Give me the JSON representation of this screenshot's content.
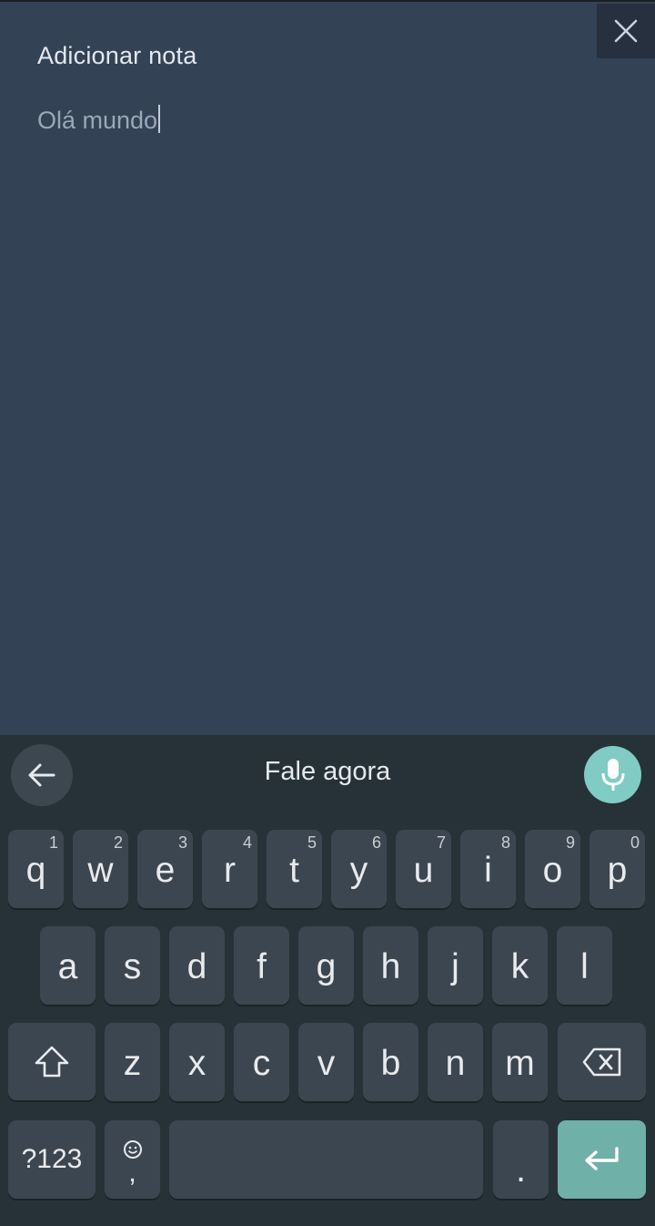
{
  "note": {
    "title": "Adicionar nota",
    "text": "Olá mundo"
  },
  "keyboard": {
    "voice_prompt": "Fale agora",
    "row1": [
      {
        "label": "q",
        "hint": "1"
      },
      {
        "label": "w",
        "hint": "2"
      },
      {
        "label": "e",
        "hint": "3"
      },
      {
        "label": "r",
        "hint": "4"
      },
      {
        "label": "t",
        "hint": "5"
      },
      {
        "label": "y",
        "hint": "6"
      },
      {
        "label": "u",
        "hint": "7"
      },
      {
        "label": "i",
        "hint": "8"
      },
      {
        "label": "o",
        "hint": "9"
      },
      {
        "label": "p",
        "hint": "0"
      }
    ],
    "row2": [
      "a",
      "s",
      "d",
      "f",
      "g",
      "h",
      "j",
      "k",
      "l"
    ],
    "row3": [
      "z",
      "x",
      "c",
      "v",
      "b",
      "n",
      "m"
    ],
    "symbols_label": "?123",
    "comma_label": ",",
    "period_label": "."
  },
  "colors": {
    "note_bg": "#344255",
    "keyboard_bg": "#263238",
    "key_bg": "#3c4650",
    "accent": "#80cbc4",
    "enter_bg": "#6fb0a8"
  }
}
